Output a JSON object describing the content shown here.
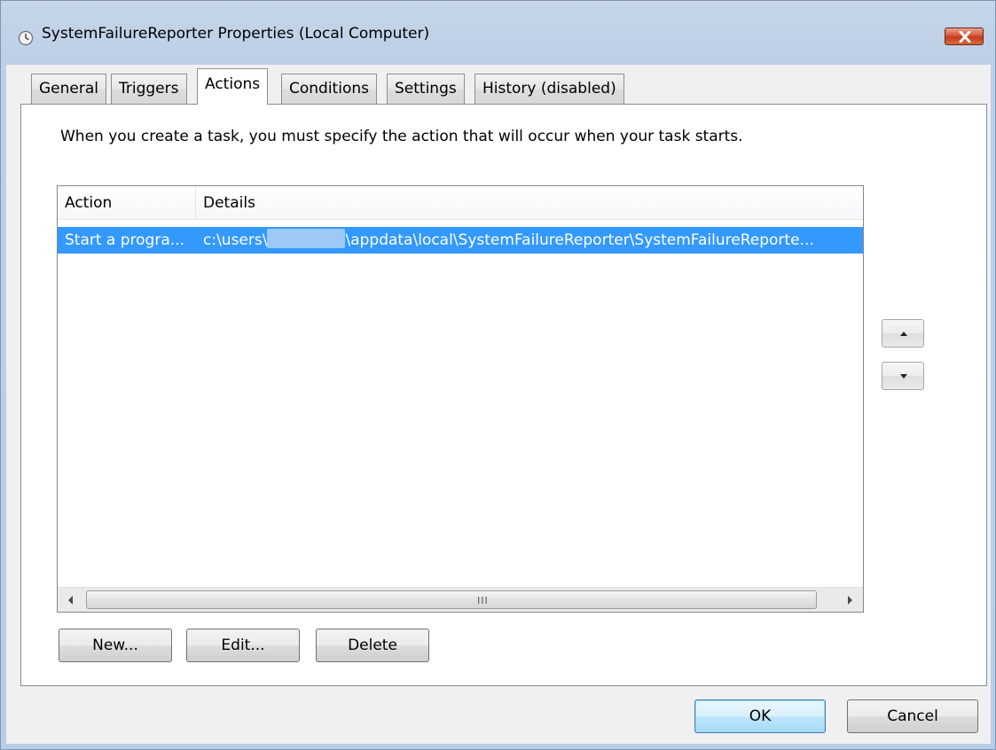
{
  "window": {
    "title": "SystemFailureReporter Properties (Local Computer)",
    "title_icon": "clock-icon",
    "close_icon": "close-icon",
    "close_color": "#c9442a"
  },
  "tabs": [
    {
      "label": "General",
      "active": false
    },
    {
      "label": "Triggers",
      "active": false
    },
    {
      "label": "Actions",
      "active": true
    },
    {
      "label": "Conditions",
      "active": false
    },
    {
      "label": "Settings",
      "active": false
    },
    {
      "label": "History (disabled)",
      "active": false
    }
  ],
  "actions": {
    "description": "When you create a task, you must specify the action that will occur when your task starts.",
    "columns": [
      "Action",
      "Details"
    ],
    "rows": [
      {
        "action": "Start a progra...",
        "details_prefix": "c:\\users\\",
        "details_suffix": "\\appdata\\local\\SystemFailureReporter\\SystemFailureReporte...",
        "selected": true
      }
    ],
    "scrollbar_grip": "III",
    "move_up_icon": "triangle-up-icon",
    "move_down_icon": "triangle-down-icon",
    "buttons": {
      "new": "New...",
      "edit": "Edit...",
      "delete": "Delete"
    }
  },
  "footer": {
    "ok": "OK",
    "cancel": "Cancel"
  },
  "colors": {
    "selection": "#3399ff",
    "frame": "#bccfe6",
    "client": "#f0f0f0"
  }
}
